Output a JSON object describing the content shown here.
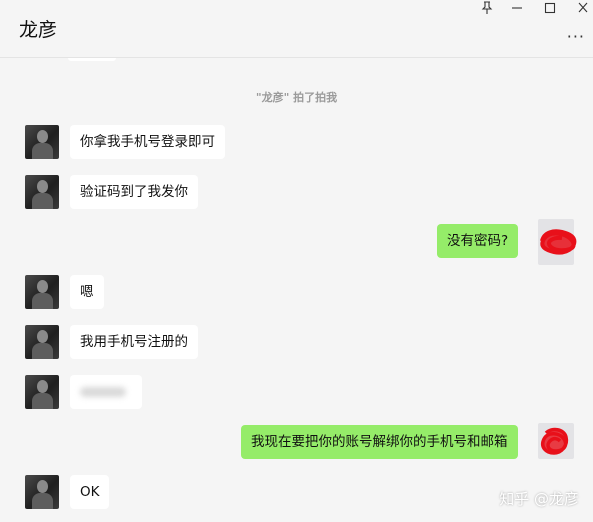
{
  "header": {
    "title": "龙彦",
    "pin_icon": "pin-icon",
    "minimize_icon": "minimize-icon",
    "maximize_icon": "maximize-icon",
    "close_icon": "close-icon",
    "more_icon": "more-icon"
  },
  "system_message": "\"龙彦\" 拍了拍我",
  "messages": [
    {
      "side": "left",
      "text": "你拿我手机号登录即可"
    },
    {
      "side": "left",
      "text": "验证码到了我发你"
    },
    {
      "side": "right",
      "text": "没有密码?"
    },
    {
      "side": "left",
      "text": "嗯"
    },
    {
      "side": "left",
      "text": "我用手机号注册的"
    },
    {
      "side": "left",
      "text": ""
    },
    {
      "side": "right",
      "text": "我现在要把你的账号解绑你的手机号和邮箱"
    },
    {
      "side": "left",
      "text": "OK"
    }
  ],
  "watermark": "知乎 @龙彦",
  "colors": {
    "background": "#f5f5f5",
    "incoming_bubble": "#ffffff",
    "outgoing_bubble": "#95ec69",
    "scribble": "#e8101a"
  }
}
